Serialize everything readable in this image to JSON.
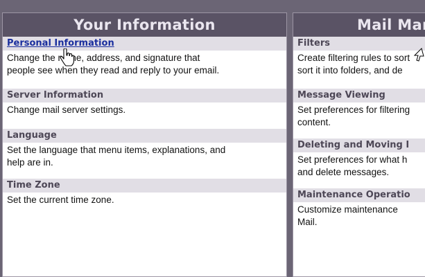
{
  "left_panel": {
    "header": "Your Information",
    "sections": [
      {
        "title": "Personal Information",
        "desc_lines": [
          "Change the name, address, and signature that",
          "people see when they read and reply to your email."
        ]
      },
      {
        "title": "Server Information",
        "desc_lines": [
          "Change mail server settings."
        ]
      },
      {
        "title": "Language",
        "desc_lines": [
          "Set the language that menu items, explanations, and",
          "help are in."
        ]
      },
      {
        "title": "Time Zone",
        "desc_lines": [
          "Set the current time zone."
        ]
      }
    ]
  },
  "right_panel": {
    "header": "Mail Mar",
    "sections": [
      {
        "title": "Filters",
        "desc_lines": [
          "Create filtering rules to sort",
          "sort it into folders, and de"
        ]
      },
      {
        "title": "Message Viewing",
        "desc_lines": [
          "Set preferences for filtering",
          "content."
        ]
      },
      {
        "title": "Deleting and Moving I",
        "desc_lines": [
          "Set preferences for what h",
          "and delete messages."
        ]
      },
      {
        "title": "Maintenance Operatio",
        "desc_lines": [
          "Customize maintenance",
          "Mail."
        ]
      }
    ]
  },
  "cursors": {
    "hand": "hand-pointer-icon",
    "arrow": "arrow-cursor-icon"
  }
}
